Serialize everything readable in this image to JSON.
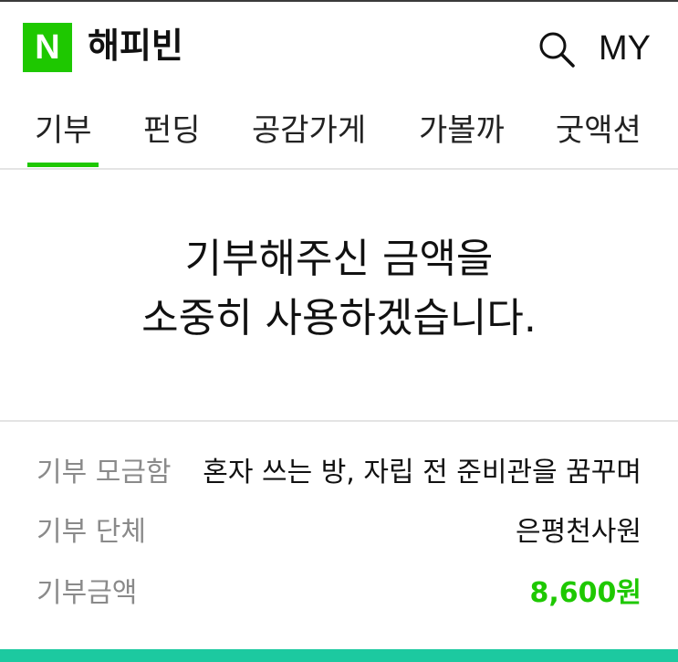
{
  "header": {
    "logo_letter": "N",
    "brand": "해피빈",
    "search_icon": "search-icon",
    "my_label": "MY"
  },
  "tabs": [
    {
      "label": "기부",
      "active": true
    },
    {
      "label": "펀딩",
      "active": false
    },
    {
      "label": "공감가게",
      "active": false
    },
    {
      "label": "가볼까",
      "active": false
    },
    {
      "label": "굿액션",
      "active": false
    }
  ],
  "thanks": {
    "line1": "기부해주신 금액을",
    "line2": "소중히 사용하겠습니다."
  },
  "details": {
    "box_label": "기부 모금함",
    "box_value": "혼자 쓰는 방, 자립 전 준비관을 꿈꾸며",
    "org_label": "기부 단체",
    "org_value": "은평천사원",
    "amount_label": "기부금액",
    "amount_value": "8,600원"
  },
  "colors": {
    "brand_green": "#1ec800",
    "amount_green": "#1ec800",
    "bottom_bar": "#1cc9a0"
  }
}
